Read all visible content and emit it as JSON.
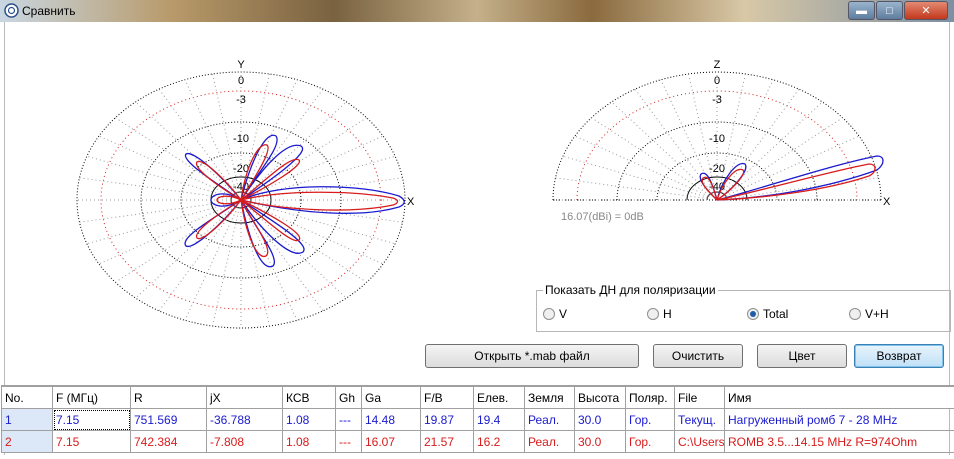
{
  "window": {
    "title": "Сравнить"
  },
  "plots": {
    "left": {
      "axis_y": "Y",
      "axis_x": "X",
      "rings": [
        "0",
        "-3",
        "-10",
        "-20",
        "-40"
      ]
    },
    "right": {
      "axis_z": "Z",
      "axis_x": "X",
      "rings": [
        "0",
        "-3",
        "-10",
        "-20",
        "-40"
      ],
      "gain_note": "16.07(dBi) = 0dB"
    }
  },
  "polarization": {
    "legend": "Показать ДН для поляризации",
    "options": [
      {
        "label": "V",
        "selected": false
      },
      {
        "label": "H",
        "selected": false
      },
      {
        "label": "Total",
        "selected": true
      },
      {
        "label": "V+H",
        "selected": false
      }
    ]
  },
  "buttons": {
    "open": "Открыть *.mab файл",
    "clear": "Очистить",
    "color": "Цвет",
    "back": "Возврат"
  },
  "table": {
    "columns": [
      "No.",
      "F (МГц)",
      "R",
      "jX",
      "КСВ",
      "Gh",
      "Ga",
      "F/B",
      "Елев.",
      "Земля",
      "Высота",
      "Поляр.",
      "File",
      "Имя"
    ],
    "rows": [
      [
        "1",
        "7.15",
        "751.569",
        "-36.788",
        "1.08",
        "---",
        "14.48",
        "19.87",
        "19.4",
        "Реал.",
        "30.0",
        "Гор.",
        "Текущ.",
        "Нагруженный ромб 7 - 28 MHz"
      ],
      [
        "2",
        "7.15",
        "742.384",
        "-7.808",
        "1.08",
        "---",
        "16.07",
        "21.57",
        "16.2",
        "Реал.",
        "30.0",
        "Гор.",
        "C:\\Users",
        "ROMB 3.5...14.15 MHz R=974Ohm"
      ]
    ]
  },
  "colors": {
    "series1": "#1a1ad0",
    "series2": "#d81b1b"
  }
}
